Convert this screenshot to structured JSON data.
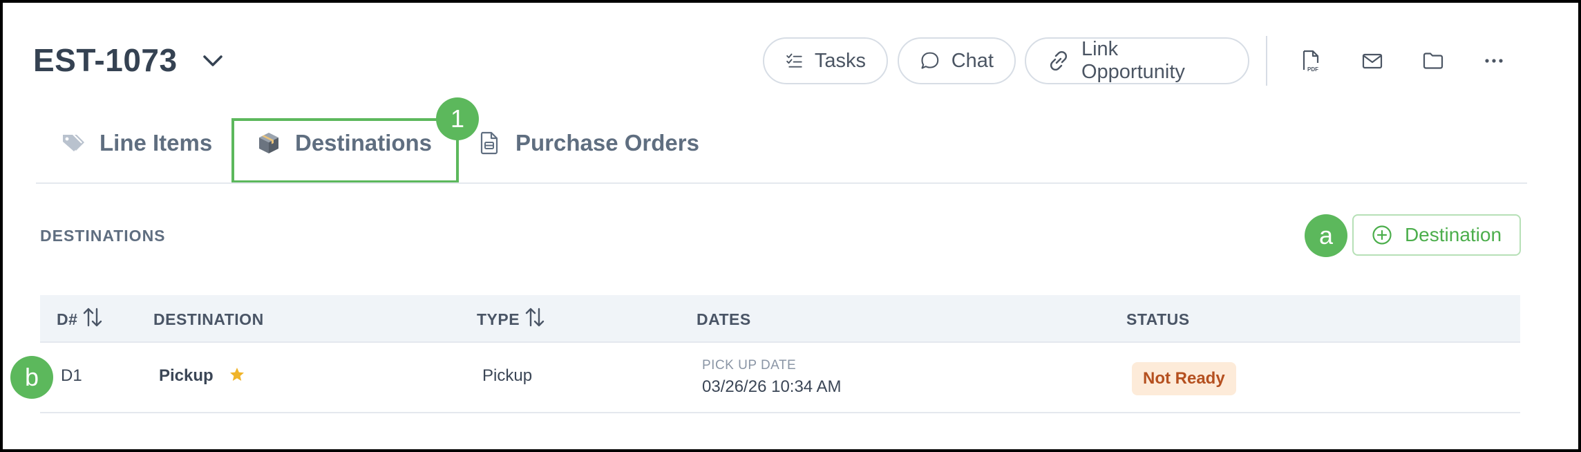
{
  "header": {
    "title": "EST-1073",
    "buttons": {
      "tasks": "Tasks",
      "chat": "Chat",
      "link_opportunity": "Link Opportunity"
    },
    "icons": [
      "pdf-icon",
      "mail-icon",
      "folder-icon",
      "more-icon"
    ]
  },
  "tabs": [
    {
      "label": "Line Items",
      "icon": "tag-icon"
    },
    {
      "label": "Destinations",
      "icon": "box-icon",
      "active": true
    },
    {
      "label": "Purchase Orders",
      "icon": "document-icon"
    }
  ],
  "annotations": {
    "tab_badge": "1",
    "button_badge": "a",
    "row_badge": "b"
  },
  "section": {
    "title": "DESTINATIONS",
    "add_button": "Destination"
  },
  "table": {
    "columns": [
      "D#",
      "DESTINATION",
      "TYPE",
      "DATES",
      "STATUS"
    ],
    "rows": [
      {
        "id": "D1",
        "destination": "Pickup",
        "type": "Pickup",
        "date_label": "PICK UP DATE",
        "date_value": "03/26/26 10:34 AM",
        "status": "Not Ready"
      }
    ]
  },
  "colors": {
    "accent_green": "#5cb85c",
    "status_bg": "#fdebd9",
    "status_text": "#b5501f",
    "star": "#f0b429"
  }
}
